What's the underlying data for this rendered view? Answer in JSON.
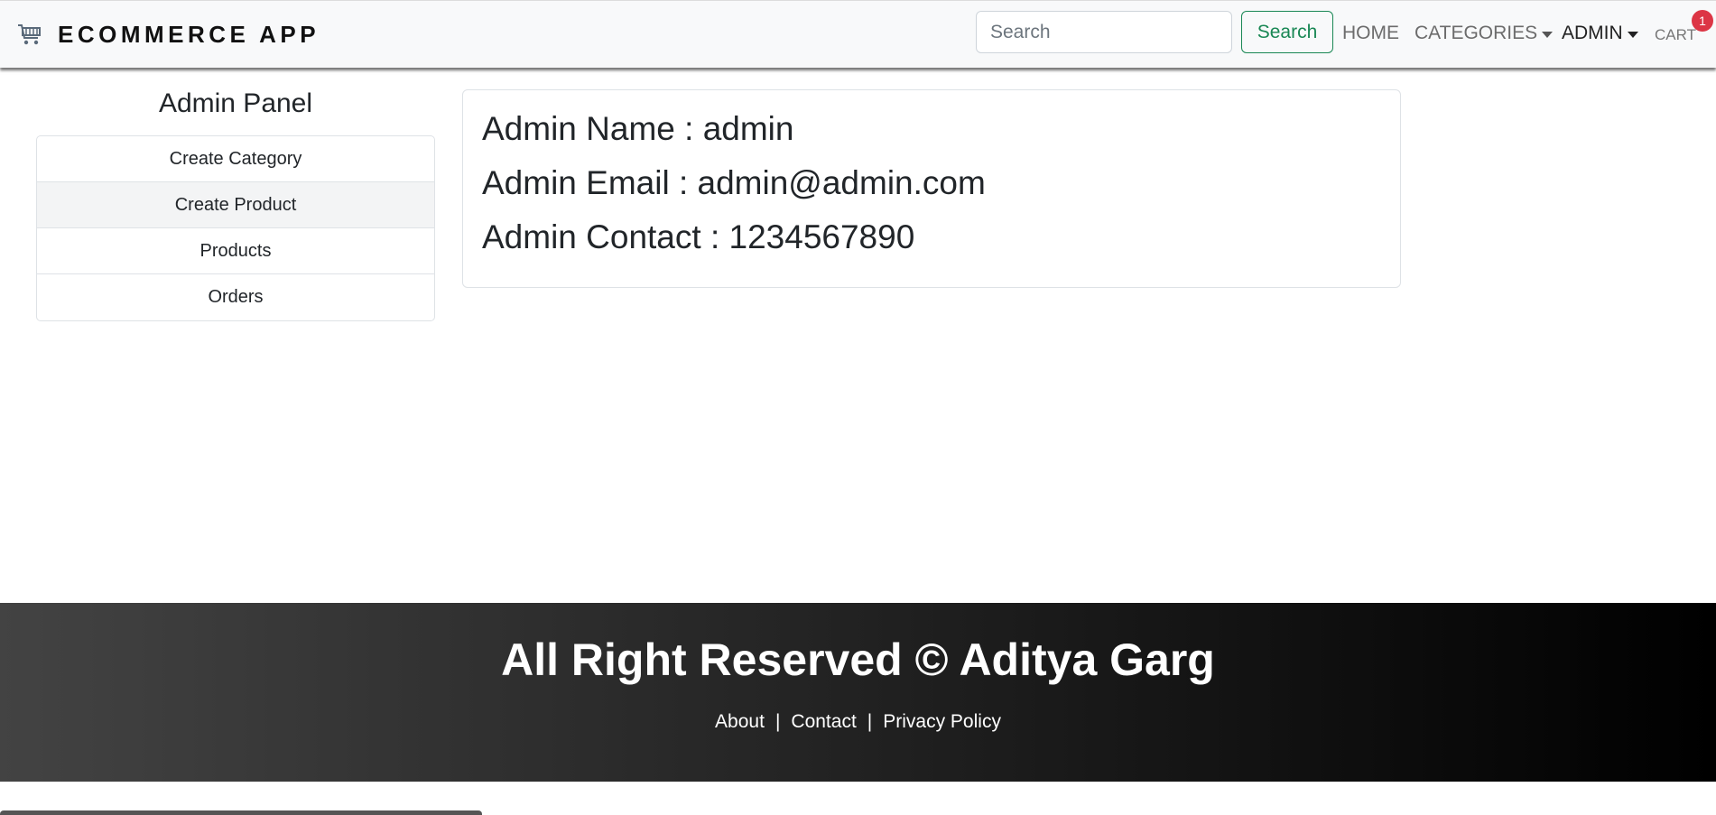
{
  "navbar": {
    "brand_icon": "shopping-cart-icon",
    "brand": "ECOMMERCE APP",
    "search_placeholder": "Search",
    "search_button": "Search",
    "home": "HOME",
    "categories": "CATEGORIES",
    "admin": "ADMIN",
    "cart": "CART",
    "cart_count": "1"
  },
  "sidebar": {
    "title": "Admin Panel",
    "items": [
      {
        "label": "Create Category"
      },
      {
        "label": "Create Product"
      },
      {
        "label": "Products"
      },
      {
        "label": "Orders"
      }
    ]
  },
  "admin_info": {
    "name": "Admin Name : admin",
    "email": "Admin Email : admin@admin.com",
    "contact": "Admin Contact : 1234567890"
  },
  "footer": {
    "title": "All Right Reserved © Aditya Garg",
    "links": [
      "About",
      "Contact",
      "Privacy Policy"
    ],
    "separator": "|"
  },
  "colors": {
    "success": "#198754",
    "badge": "#dc3545",
    "footer_start": "#434343",
    "footer_end": "#000000"
  }
}
